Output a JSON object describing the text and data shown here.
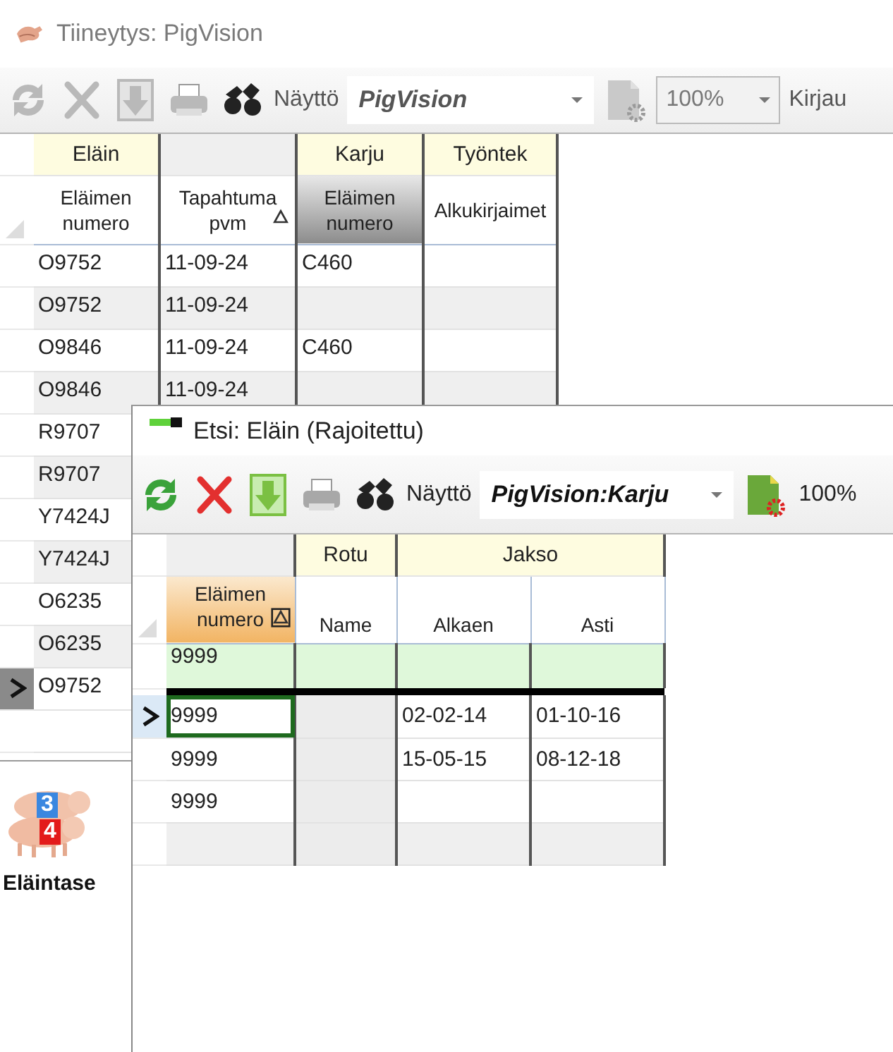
{
  "window": {
    "title": "Tiineytys: PigVision"
  },
  "toolbar": {
    "buttons": [
      {
        "kind": "refresh",
        "disabled": true
      },
      {
        "kind": "delete",
        "disabled": true
      },
      {
        "kind": "download",
        "disabled": true
      },
      {
        "kind": "print",
        "disabled": true
      },
      {
        "kind": "find",
        "disabled": false
      }
    ],
    "view_label": "Näyttö",
    "view_value": "PigVision",
    "settings": {
      "disabled": true
    },
    "zoom_value": "100%",
    "cut_label": "Kirjau"
  },
  "grid": {
    "groups": [
      {
        "label": "Eläin",
        "columns": [
          {
            "label": "Eläimen numero",
            "sorted": false,
            "selected": false
          }
        ]
      },
      {
        "columns": [
          {
            "label": "Tapahtuma pvm",
            "sorted": true,
            "selected": false
          }
        ]
      },
      {
        "label": "Karju",
        "columns": [
          {
            "label": "Eläimen numero",
            "sorted": false,
            "selected": true
          }
        ]
      },
      {
        "label": "Työntek",
        "columns": [
          {
            "label": "Alkukirjaimet",
            "sorted": false,
            "selected": false
          }
        ]
      }
    ],
    "rows": [
      {
        "cells": [
          "O9752",
          "11-09-24",
          "C460",
          null
        ],
        "current": false
      },
      {
        "cells": [
          "O9752",
          "11-09-24",
          null,
          null
        ],
        "current": false
      },
      {
        "cells": [
          "O9846",
          "11-09-24",
          "C460",
          null
        ],
        "current": false
      },
      {
        "cells": [
          "O9846",
          "11-09-24",
          null,
          null
        ],
        "current": false
      },
      {
        "cells": [
          "R9707"
        ],
        "current": false
      },
      {
        "cells": [
          "R9707"
        ],
        "current": false
      },
      {
        "cells": [
          "Y7424J"
        ],
        "current": false
      },
      {
        "cells": [
          "Y7424J"
        ],
        "current": false
      },
      {
        "cells": [
          "O6235"
        ],
        "current": false
      },
      {
        "cells": [
          "O6235"
        ],
        "current": false
      },
      {
        "cells": [
          "O9752"
        ],
        "current": true
      }
    ]
  },
  "sidebar": {
    "items": [
      {
        "label": "Eläintase",
        "numbers": [
          "3",
          "4"
        ]
      }
    ]
  },
  "dialog": {
    "title": "Etsi: Eläin (Rajoitettu)",
    "toolbar": {
      "buttons": [
        {
          "kind": "refresh",
          "disabled": false
        },
        {
          "kind": "delete",
          "disabled": false
        },
        {
          "kind": "download",
          "disabled": false
        },
        {
          "kind": "print",
          "disabled": false
        },
        {
          "kind": "find",
          "disabled": false
        }
      ],
      "view_label": "Näyttö",
      "view_value": "PigVision:Karju",
      "settings": {
        "disabled": false
      },
      "zoom_value": "100%"
    },
    "grid": {
      "groups": [
        {
          "columns": [
            {
              "label": "Eläimen numero",
              "sorted": true,
              "selected": true,
              "disabled": false
            }
          ]
        },
        {
          "label": "Rotu",
          "columns": [
            {
              "label": "Name",
              "sorted": false,
              "selected": false,
              "disabled": true
            }
          ]
        },
        {
          "label": "Jakso",
          "columns": [
            {
              "label": "Alkaen",
              "sorted": false,
              "selected": false,
              "disabled": false
            },
            {
              "label": "Asti",
              "sorted": false,
              "selected": false,
              "disabled": false
            }
          ]
        }
      ],
      "filter_row": {
        "cells": [
          "9999",
          null,
          null,
          null
        ]
      },
      "rows": [
        {
          "cells": [
            "9999",
            null,
            "02-02-14",
            "01-10-16"
          ],
          "current": true
        },
        {
          "cells": [
            "9999",
            null,
            "15-05-15",
            "08-12-18"
          ],
          "current": false
        },
        {
          "cells": [
            "9999",
            null,
            null,
            null
          ],
          "current": false
        }
      ]
    }
  }
}
